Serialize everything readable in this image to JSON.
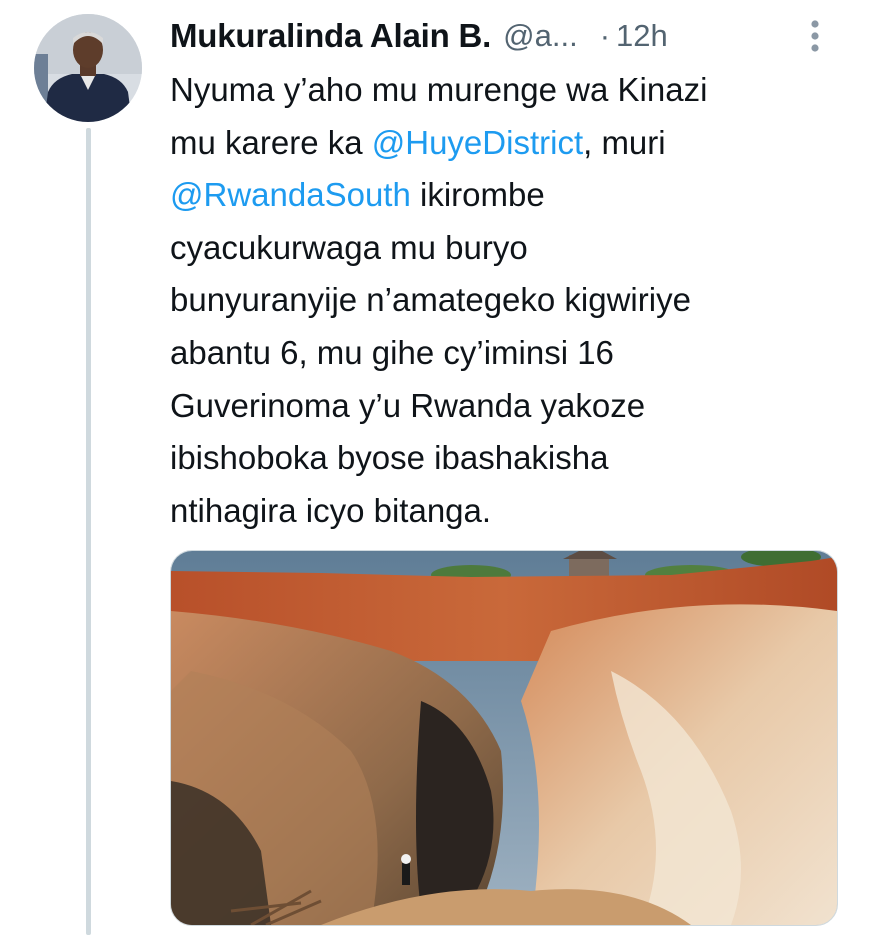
{
  "tweet": {
    "author": {
      "display_name": "Mukuralinda Alain B.",
      "handle": "@a...",
      "avatar_icon": "profile-photo"
    },
    "separator": "·",
    "timestamp": "12h",
    "more_icon": "more-vertical-icon",
    "text_lines": [
      [
        {
          "t": "Nyuma y’aho mu murenge wa Kinazi"
        }
      ],
      [
        {
          "t": "mu karere ka "
        },
        {
          "t": "@HuyeDistrict",
          "mention": true
        },
        {
          "t": ", muri"
        }
      ],
      [
        {
          "t": "@RwandaSouth",
          "mention": true
        },
        {
          "t": " ikirombe"
        }
      ],
      [
        {
          "t": "cyacukurwaga mu buryo"
        }
      ],
      [
        {
          "t": "bunyuranyije n’amategeko kigwiriye"
        }
      ],
      [
        {
          "t": "abantu 6, mu gihe cy’iminsi 16"
        }
      ],
      [
        {
          "t": "Guverinoma y’u Rwanda yakoze"
        }
      ],
      [
        {
          "t": "ibishoboka byose ibashakisha"
        }
      ],
      [
        {
          "t": "ntihagira icyo bitanga."
        }
      ]
    ],
    "media": {
      "kind": "photo",
      "subject": "open-pit-mine"
    }
  },
  "colors": {
    "text": "#0f1419",
    "secondary": "#536471",
    "link": "#1d9bf0",
    "thread_line": "#cfd9de"
  }
}
